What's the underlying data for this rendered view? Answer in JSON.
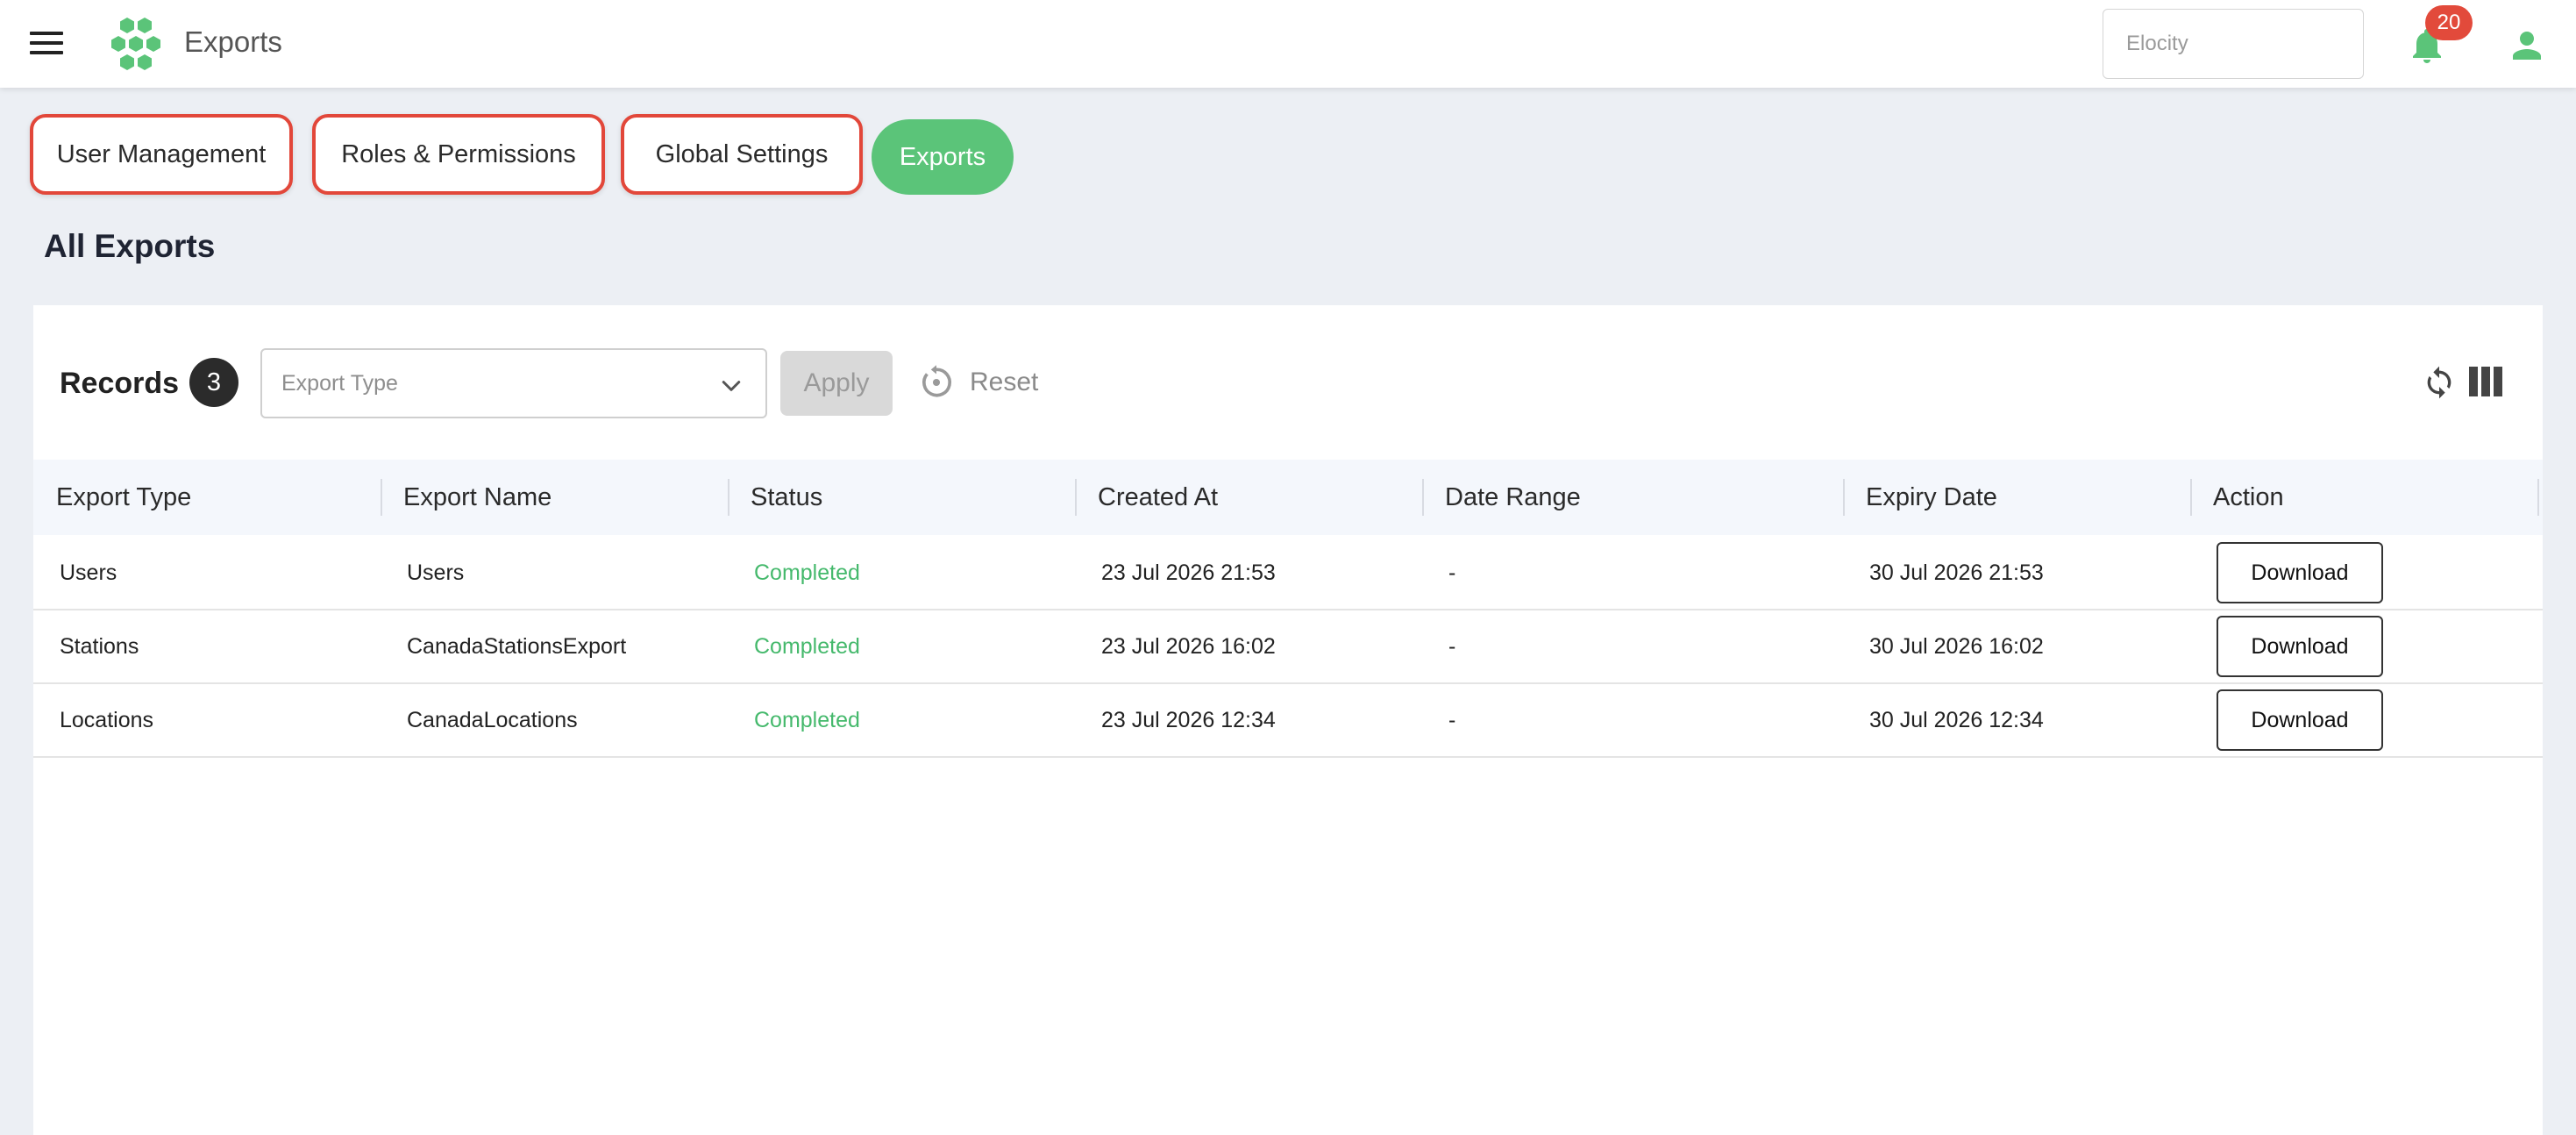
{
  "header": {
    "app_title": "Exports",
    "org_placeholder": "Elocity",
    "notification_count": "20",
    "icons": [
      "menu-icon",
      "logo-hexagon-icon",
      "bell-icon",
      "user-icon"
    ],
    "brand_color": "#5bc479"
  },
  "tabs": [
    {
      "label": "User Management",
      "active": false
    },
    {
      "label": "Roles & Permissions",
      "active": false
    },
    {
      "label": "Global Settings",
      "active": false
    },
    {
      "label": "Exports",
      "active": true
    }
  ],
  "page": {
    "title": "All Exports"
  },
  "toolbar": {
    "records_label": "Records",
    "records_count": "3",
    "filter_placeholder": "Export Type",
    "apply_label": "Apply",
    "reset_label": "Reset"
  },
  "table": {
    "columns": [
      "Export Type",
      "Export Name",
      "Status",
      "Created At",
      "Date Range",
      "Expiry Date",
      "Action"
    ],
    "rows": [
      {
        "export_type": "Users",
        "export_name": "Users",
        "status": "Completed",
        "created_at": "23 Jul 2026 21:53",
        "date_range": "-",
        "expiry_date": "30 Jul 2026 21:53",
        "action": "Download"
      },
      {
        "export_type": "Stations",
        "export_name": "CanadaStationsExport",
        "status": "Completed",
        "created_at": "23 Jul 2026 16:02",
        "date_range": "-",
        "expiry_date": "30 Jul 2026 16:02",
        "action": "Download"
      },
      {
        "export_type": "Locations",
        "export_name": "CanadaLocations",
        "status": "Completed",
        "created_at": "23 Jul 2026 12:34",
        "date_range": "-",
        "expiry_date": "30 Jul 2026 12:34",
        "action": "Download"
      }
    ],
    "status_color": "#45b96c"
  }
}
